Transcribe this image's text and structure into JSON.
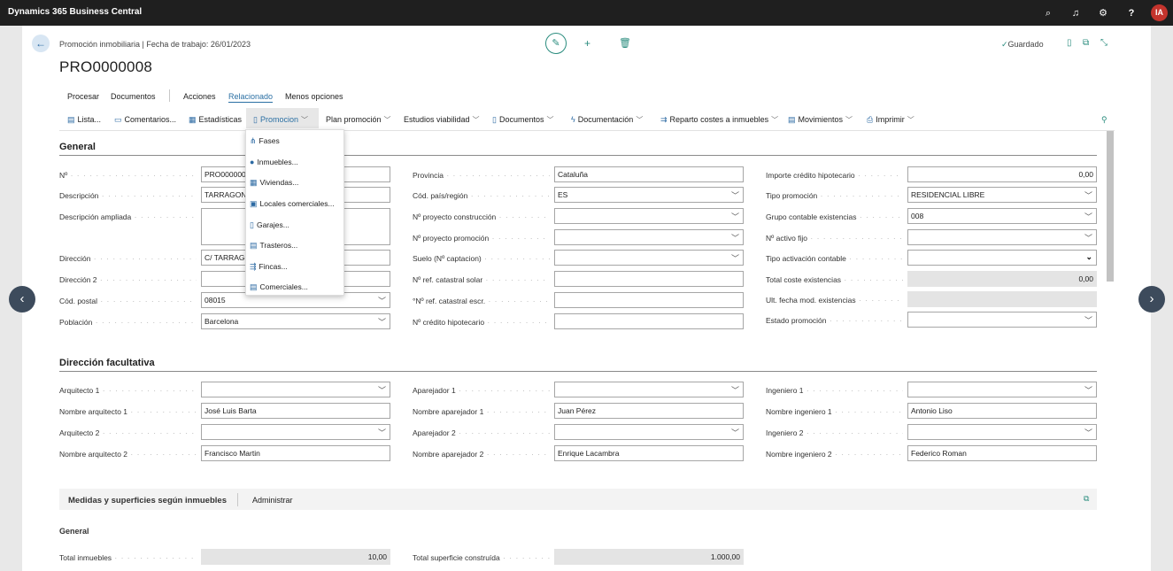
{
  "app": {
    "title": "Dynamics 365 Business Central",
    "user_initials": "IA"
  },
  "topbar_icons": [
    "search-icon",
    "bell-icon",
    "gear-icon",
    "help-icon"
  ],
  "header": {
    "breadcrumb": "Promoción inmobiliaria | Fecha de trabajo: 26/01/2023",
    "record_no": "PRO0000008",
    "saved": "Guardado"
  },
  "actions": {
    "procesar": "Procesar",
    "documentos": "Documentos",
    "acciones": "Acciones",
    "relacionado": "Relacionado",
    "menos": "Menos opciones"
  },
  "toolbar": {
    "lista": "Lista...",
    "comentarios": "Comentarios...",
    "estadisticas": "Estadísticas",
    "promocion": "Promocion",
    "plan": "Plan promoción",
    "estudios": "Estudios viabilidad",
    "documentos": "Documentos",
    "documentacion": "Documentación",
    "reparto": "Reparto costes a inmuebles",
    "movimientos": "Movimientos",
    "imprimir": "Imprimir"
  },
  "promocion_menu": {
    "fases": "Fases",
    "inmuebles": "Inmuebles...",
    "viviendas": "Viviendas...",
    "locales": "Locales comerciales...",
    "garajes": "Garajes...",
    "trasteros": "Trasteros...",
    "fincas": "Fincas...",
    "comerciales": "Comerciales..."
  },
  "general": {
    "title": "General",
    "no_label": "Nº",
    "no_value": "PRO0000008",
    "descripcion_label": "Descripción",
    "descripcion_value": "TARRAGONA",
    "desc_ampliada_label": "Descripción ampliada",
    "desc_ampliada_value": "",
    "direccion_label": "Dirección",
    "direccion_value": "C/ TARRAGONA",
    "direccion2_label": "Dirección 2",
    "direccion2_value": "",
    "cp_label": "Cód. postal",
    "cp_value": "08015",
    "poblacion_label": "Población",
    "poblacion_value": "Barcelona",
    "provincia_label": "Provincia",
    "provincia_value": "Cataluña",
    "pais_label": "Cód. país/región",
    "pais_value": "ES",
    "proy_constr_label": "Nº proyecto construcción",
    "proy_constr_value": "",
    "proy_prom_label": "Nº proyecto promoción",
    "proy_prom_value": "",
    "suelo_label": "Suelo (Nº captacion)",
    "suelo_value": "",
    "ref_solar_label": "Nº ref. catastral solar",
    "ref_solar_value": "",
    "ref_escr_label": "°Nº ref. catastral escr.",
    "ref_escr_value": "",
    "credito_hip_label": "Nº crédito hipotecario",
    "credito_hip_value": "",
    "importe_label": "Importe crédito hipotecario",
    "importe_value": "0,00",
    "tipo_prom_label": "Tipo promoción",
    "tipo_prom_value": "RESIDENCIAL LIBRE",
    "grupo_label": "Grupo contable existencias",
    "grupo_value": "008",
    "activo_label": "Nº activo fijo",
    "activo_value": "",
    "tipo_act_label": "Tipo activación contable",
    "tipo_act_value": "",
    "total_coste_label": "Total coste existencias",
    "total_coste_value": "0,00",
    "ult_fecha_label": "Ult. fecha mod. existencias",
    "ult_fecha_value": "",
    "estado_label": "Estado promoción",
    "estado_value": ""
  },
  "direccion_facultativa": {
    "title": "Dirección facultativa",
    "arq1_label": "Arquitecto 1",
    "arq1_value": "",
    "narq1_label": "Nombre arquitecto 1",
    "narq1_value": "José Luis Barta",
    "arq2_label": "Arquitecto 2",
    "arq2_value": "",
    "narq2_label": "Nombre arquitecto 2",
    "narq2_value": "Francisco Martin",
    "apa1_label": "Aparejador 1",
    "apa1_value": "",
    "napa1_label": "Nombre aparejador 1",
    "napa1_value": "Juan Pérez",
    "apa2_label": "Aparejador 2",
    "apa2_value": "",
    "napa2_label": "Nombre aparejador 2",
    "napa2_value": "Enrique Lacambra",
    "ing1_label": "Ingeniero 1",
    "ing1_value": "",
    "ning1_label": "Nombre ingeniero 1",
    "ning1_value": "Antonio Liso",
    "ing2_label": "Ingeniero 2",
    "ing2_value": "",
    "ning2_label": "Nombre ingeniero 2",
    "ning2_value": "Federico Roman"
  },
  "medidas": {
    "title": "Medidas y superficies según inmuebles",
    "administrar": "Administrar",
    "general": "General",
    "total_inm_label": "Total inmuebles",
    "total_inm_value": "10,00",
    "total_sup_label": "Total superficie construída",
    "total_sup_value": "1.000,00"
  }
}
